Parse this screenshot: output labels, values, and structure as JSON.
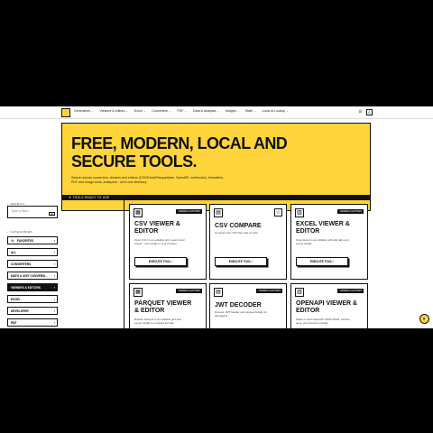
{
  "nav": {
    "items": [
      {
        "label": "Generators",
        "chev": "⌄"
      },
      {
        "label": "Viewers & editors",
        "chev": "⌄"
      },
      {
        "label": "Excel",
        "chev": "⌄"
      },
      {
        "label": "Converters",
        "chev": "⌄"
      },
      {
        "label": "PDF",
        "chev": "⌄"
      },
      {
        "label": "Data & Analysis",
        "chev": "⌄"
      },
      {
        "label": "Images",
        "chev": "⌄"
      },
      {
        "label": "Math",
        "chev": "⌄"
      },
      {
        "label": "Local AI Lookup",
        "chev": "⌄"
      }
    ],
    "github_icon": "⊙",
    "search_icon": "⌕"
  },
  "logo": {
    "glyph": "⚡"
  },
  "hero": {
    "title": "FREE, MODERN, LOCAL AND SECURE TOOLS.",
    "subtitle": "Search across converters, viewers and editors (CSV/Excel/Parquet/jwts, OpenAPI, webhooks), formatters, PDF and image tools, analyzers - all in one directory."
  },
  "stripe_label": "▼ TOOLS READY TO USE",
  "sidebar": {
    "search_label": "⌕ SEARCH",
    "search_placeholder": "Type to filter...",
    "search_go": "Go",
    "categories_label": "⌕ CATEGORIES",
    "categories": [
      {
        "label": "FAVORITES",
        "icon": "☆",
        "chev": "›"
      },
      {
        "label": "ALL",
        "chev": "›"
      },
      {
        "label": "CONVERTERS",
        "chev": "›"
      },
      {
        "label": "MATH & UNIT CONVERSI...",
        "chev": "›"
      },
      {
        "label": "VIEWERS & EDITORS",
        "chev": "›",
        "active": true
      },
      {
        "label": "EXCEL",
        "chev": "›"
      },
      {
        "label": "DEVELOPER",
        "chev": "›"
      },
      {
        "label": "PDF",
        "chev": "›"
      }
    ]
  },
  "cards": [
    {
      "title": "CSV VIEWER & EDITOR",
      "badge": "VIEWERS & EDITORS",
      "icon": "▦",
      "desc": "Open CSV in an editable grid, search and export - now locally in your browser.",
      "btn": "EXECUTE TOOL ›"
    },
    {
      "title": "CSV COMPARE",
      "badge": "VIEWERS & EDITORS",
      "icon": "▤",
      "desc": "Compare two CSV files side by side.",
      "btn": "EXECUTE TOOL ›"
    },
    {
      "title": "EXCEL VIEWER & EDITOR",
      "badge": "VIEWERS & EDITORS",
      "icon": "▥",
      "desc": "Open Excel in an editable grid with tabs and export locally.",
      "btn": "EXECUTE TOOL ›"
    },
    {
      "title": "PARQUET VIEWER & EDITOR",
      "badge": "VIEWERS & EDITORS",
      "icon": "▦",
      "desc": "Browse Parquet in an editable grid and export locally to compact formats.",
      "btn": "EXECUTE TOOL ›"
    },
    {
      "title": "JWT DECODER",
      "badge": "VIEWERS & EDITORS",
      "icon": "▤",
      "desc": "Decode JWT header and payload locally for debugging.",
      "btn": "EXECUTE TOOL ›"
    },
    {
      "title": "OPENAPI VIEWER & EDITOR",
      "badge": "VIEWERS & EDITORS",
      "icon": "▥",
      "desc": "Paste or load OpenAPI YAML/JSON, edit the spec, and preview it locally.",
      "btn": "EXECUTE TOOL ›"
    }
  ],
  "chat_icon": "◐",
  "colors": {
    "accent": "#ffd43b",
    "ink": "#111111"
  }
}
